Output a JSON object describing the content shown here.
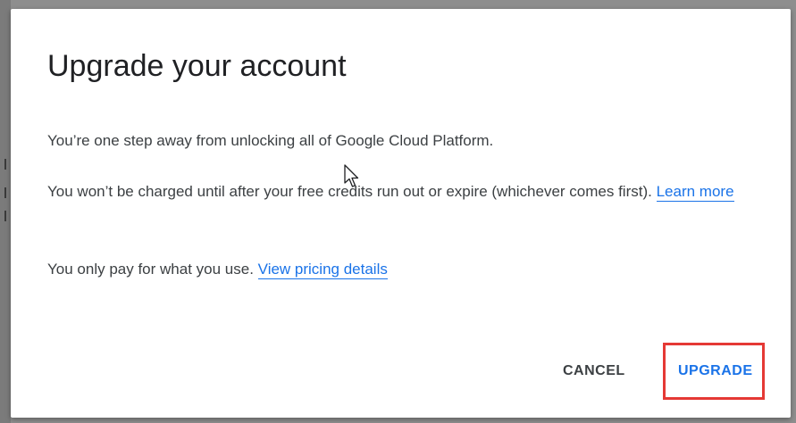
{
  "dialog": {
    "title": "Upgrade your account",
    "line1": "You’re one step away from unlocking all of Google Cloud Platform.",
    "line2": "You won’t be charged until after your free credits run out or expire (whichever comes first).",
    "learn_more": "Learn more",
    "line3": "You only pay for what you use.",
    "view_pricing": "View pricing details",
    "cancel_label": "CANCEL",
    "upgrade_label": "UPGRADE"
  },
  "colors": {
    "link": "#1a73e8",
    "highlight": "#e53935",
    "text": "#3c4043"
  }
}
